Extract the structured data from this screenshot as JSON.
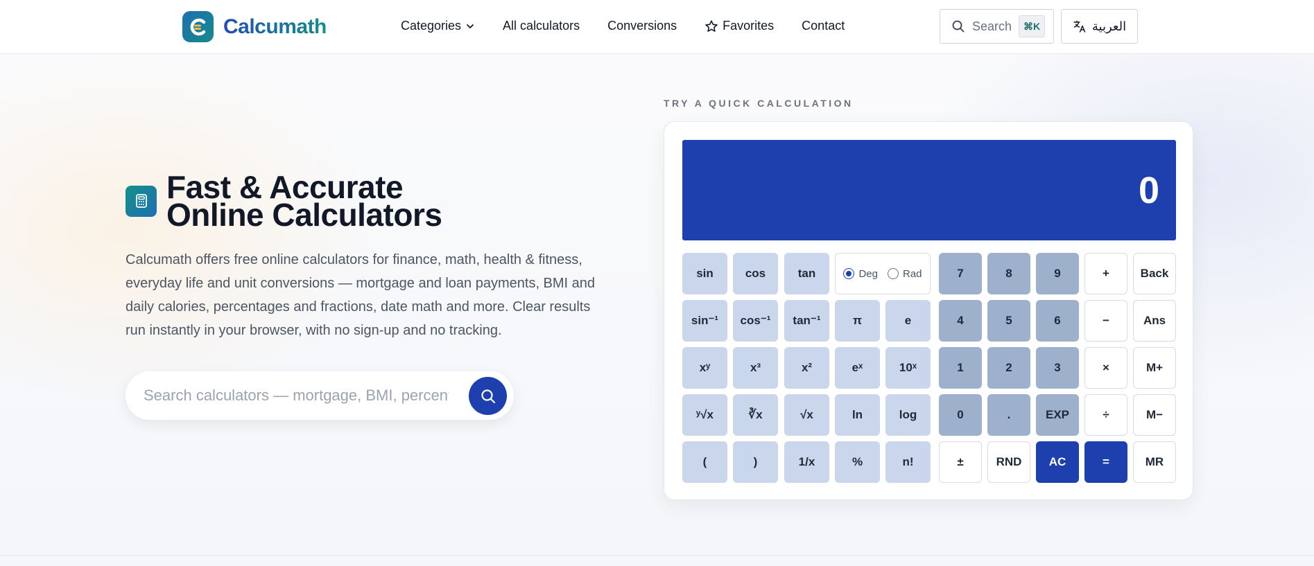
{
  "header": {
    "brand": "Calcumath",
    "nav": [
      {
        "label": "Categories"
      },
      {
        "label": "All calculators"
      },
      {
        "label": "Conversions"
      },
      {
        "label": "Favorites"
      },
      {
        "label": "Contact"
      }
    ],
    "search_label": "Search",
    "search_shortcut": "⌘K",
    "language_label": "العربية"
  },
  "hero": {
    "title_line1": "Fast & Accurate",
    "title_line2": "Online Calculators",
    "description": "Calcumath offers free online calculators for finance, math, health & fitness, everyday life and unit conversions — mortgage and loan payments, BMI and daily calories, percentages and fractions, date math and more. Clear results run instantly in your browser, with no sign-up and no tracking.",
    "search_placeholder": "Search calculators — mortgage, BMI, percentages"
  },
  "calculator": {
    "label": "TRY A QUICK CALCULATION",
    "display_value": "0",
    "angle_modes": [
      "Deg",
      "Rad"
    ],
    "angle_mode_selected": "Deg",
    "keys": {
      "sin": "sin",
      "cos": "cos",
      "tan": "tan",
      "asin": "sin⁻¹",
      "acos": "cos⁻¹",
      "atan": "tan⁻¹",
      "pi": "π",
      "e": "e",
      "xy": "xʸ",
      "x3": "x³",
      "x2": "x²",
      "ex": "eˣ",
      "tenx": "10ˣ",
      "yroot": "ʸ√x",
      "cbrt": "∛x",
      "sqrt": "√x",
      "ln": "ln",
      "log": "log",
      "lparen": "(",
      "rparen": ")",
      "inv": "1/x",
      "percent": "%",
      "fact": "n!",
      "n7": "7",
      "n8": "8",
      "n9": "9",
      "n4": "4",
      "n5": "5",
      "n6": "6",
      "n1": "1",
      "n2": "2",
      "n3": "3",
      "n0": "0",
      "dot": ".",
      "exp": "EXP",
      "plus": "+",
      "minus": "−",
      "times": "×",
      "divide": "÷",
      "equals": "=",
      "back": "Back",
      "ans": "Ans",
      "mplus": "M+",
      "mminus": "M−",
      "mr": "MR",
      "plusminus": "±",
      "rnd": "RND",
      "ac": "AC"
    }
  },
  "colors": {
    "accent": "#1e40af",
    "teal": "#15908a",
    "sci_key": "#c9d6ec",
    "num_key": "#9db0cc"
  }
}
